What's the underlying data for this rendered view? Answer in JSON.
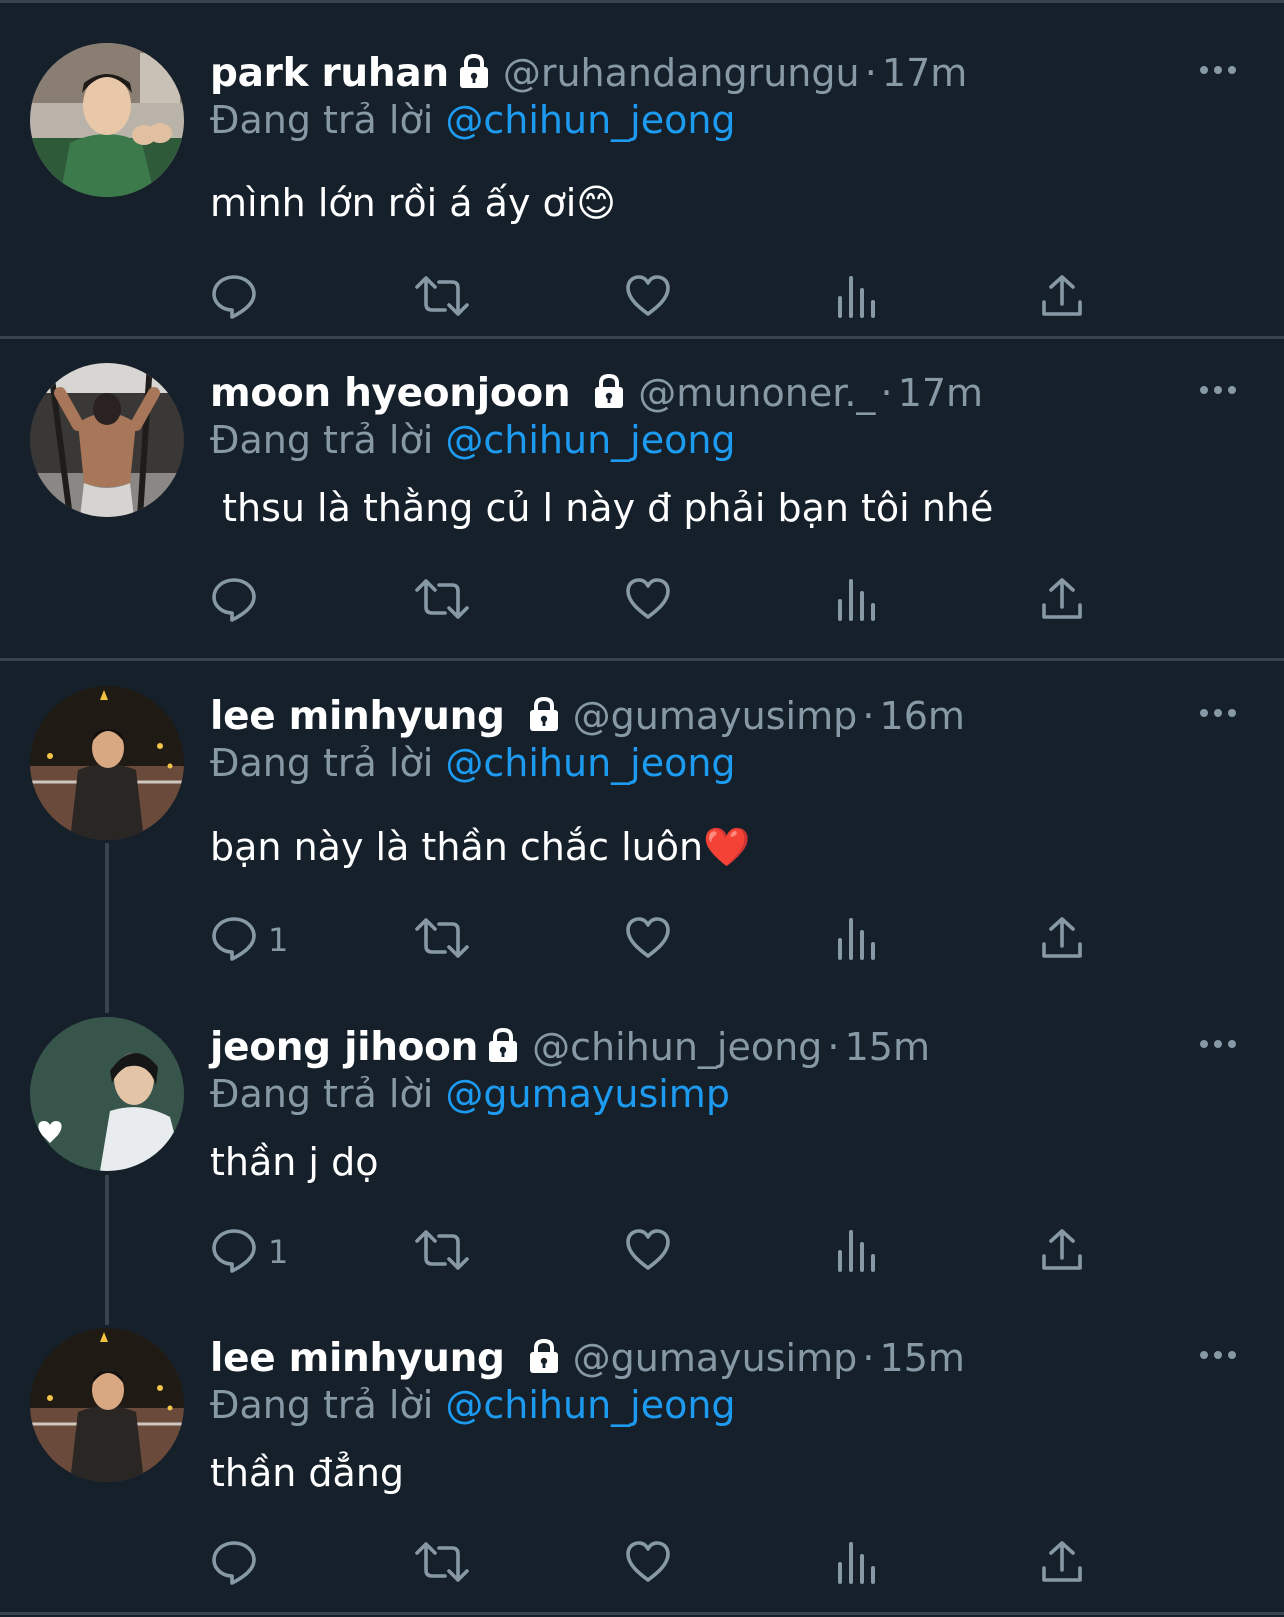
{
  "tweets": [
    {
      "name": "park ruhan",
      "handle": "@ruhandangrungu",
      "dot": "·",
      "time": "17m",
      "reply_prefix": "Đang trả lời",
      "mention": "@chihun_jeong",
      "text": "mình lớn rồi á ấy ơi😊",
      "reply_count": "",
      "avatar": "avatar-park-ruhan"
    },
    {
      "name": "moon hyeonjoon",
      "handle": "@munoner._",
      "dot": "·",
      "time": "17m",
      "reply_prefix": "Đang trả lời",
      "mention": "@chihun_jeong",
      "text": " thsu là thằng củ l này đ phải bạn tôi nhé",
      "reply_count": "",
      "avatar": "avatar-moon-hyeonjoon"
    },
    {
      "name": "lee minhyung",
      "handle": "@gumayusimp",
      "dot": "·",
      "time": "16m",
      "reply_prefix": "Đang trả lời",
      "mention": "@chihun_jeong",
      "text": "bạn này là thần chắc luôn❤️",
      "reply_count": "1",
      "avatar": "avatar-lee-minhyung"
    },
    {
      "name": "jeong jihoon",
      "handle": "@chihun_jeong",
      "dot": "·",
      "time": "15m",
      "reply_prefix": "Đang trả lời",
      "mention": "@gumayusimp",
      "text": "thần j dọ",
      "reply_count": "1",
      "avatar": "avatar-jeong-jihoon"
    },
    {
      "name": "lee minhyung",
      "handle": "@gumayusimp",
      "dot": "·",
      "time": "15m",
      "reply_prefix": "Đang trả lời",
      "mention": "@chihun_jeong",
      "text": "thần đẳng",
      "reply_count": "",
      "avatar": "avatar-lee-minhyung"
    }
  ],
  "icons": {
    "reply": "reply-icon",
    "retweet": "retweet-icon",
    "like": "heart-icon",
    "views": "views-icon",
    "share": "share-icon",
    "more": "more-icon",
    "lock": "lock-icon"
  },
  "colors": {
    "background": "#15202b",
    "divider": "#38444d",
    "secondary_text": "#8899a6",
    "mention": "#1d9bf0",
    "primary_text": "#ffffff"
  }
}
